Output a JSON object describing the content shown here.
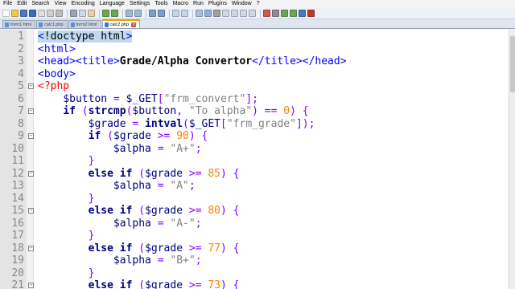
{
  "menu": [
    "File",
    "Edit",
    "Search",
    "View",
    "Encoding",
    "Language",
    "Settings",
    "Tools",
    "Macro",
    "Run",
    "Plugins",
    "Window",
    "?"
  ],
  "toolbar_icons": [
    "new-icon",
    "open-icon",
    "save-icon",
    "save-all-icon",
    "close-icon",
    "close-all-icon",
    "print-icon",
    "cut-icon",
    "copy-icon",
    "paste-icon",
    "undo-icon",
    "redo-icon",
    "find-icon",
    "replace-icon",
    "zoom-in-icon",
    "zoom-out-icon",
    "sync-v-icon",
    "sync-h-icon",
    "wrap-icon",
    "all-chars-icon",
    "indent-guide-icon",
    "udl-icon",
    "doc-map-icon",
    "function-list-icon",
    "folder-workspace-icon",
    "record-macro-icon",
    "stop-record-icon",
    "play-macro-icon",
    "run-macro-multiple-icon",
    "save-macro-icon",
    "spell-check-icon"
  ],
  "tabs": [
    {
      "label": "form1.html",
      "active": false
    },
    {
      "label": "calc1.php",
      "active": false
    },
    {
      "label": "form2.html",
      "active": false
    },
    {
      "label": "calc2.php",
      "active": true
    }
  ],
  "colors": {
    "tag": "#0000ff",
    "attr_doctype": "#000000",
    "php_delim": "#ff0000",
    "keyword": "#000080",
    "variable": "#000080",
    "string": "#808080",
    "number": "#ff8000",
    "operator": "#8000ff",
    "function": "#000080"
  },
  "lines": [
    {
      "n": "1",
      "fold": "",
      "tokens": [
        [
          "tag",
          "<"
        ],
        [
          "hlword",
          "!doctype html"
        ],
        [
          "tag",
          ">"
        ]
      ]
    },
    {
      "n": "2",
      "fold": "",
      "tokens": [
        [
          "tag",
          "<html>"
        ]
      ]
    },
    {
      "n": "3",
      "fold": "",
      "tokens": [
        [
          "tag",
          "<head><title>"
        ],
        [
          "boldtext",
          "Grade/Alpha Convertor"
        ],
        [
          "tag",
          "</title></head>"
        ]
      ]
    },
    {
      "n": "4",
      "fold": "",
      "tokens": [
        [
          "tag",
          "<body>"
        ]
      ]
    },
    {
      "n": "5",
      "fold": "-",
      "tokens": [
        [
          "php",
          "<?php"
        ]
      ]
    },
    {
      "n": "6",
      "fold": "",
      "tokens": [
        [
          "plain",
          "    "
        ],
        [
          "var",
          "$button"
        ],
        [
          "op",
          " = "
        ],
        [
          "var",
          "$_GET"
        ],
        [
          "op",
          "["
        ],
        [
          "str",
          "\"frm_convert\""
        ],
        [
          "op",
          "];"
        ]
      ]
    },
    {
      "n": "7",
      "fold": "-",
      "tokens": [
        [
          "plain",
          "    "
        ],
        [
          "kw",
          "if"
        ],
        [
          "op",
          " ("
        ],
        [
          "fn",
          "strcmp"
        ],
        [
          "op",
          "("
        ],
        [
          "var",
          "$button"
        ],
        [
          "op",
          ", "
        ],
        [
          "str",
          "\"To alpha\""
        ],
        [
          "op",
          ") == "
        ],
        [
          "num",
          "0"
        ],
        [
          "op",
          ") {"
        ]
      ]
    },
    {
      "n": "8",
      "fold": "",
      "tokens": [
        [
          "plain",
          "        "
        ],
        [
          "var",
          "$grade"
        ],
        [
          "op",
          " = "
        ],
        [
          "fn",
          "intval"
        ],
        [
          "op",
          "("
        ],
        [
          "var",
          "$_GET"
        ],
        [
          "op",
          "["
        ],
        [
          "str",
          "\"frm_grade\""
        ],
        [
          "op",
          "]);"
        ]
      ]
    },
    {
      "n": "9",
      "fold": "-",
      "tokens": [
        [
          "plain",
          "        "
        ],
        [
          "kw",
          "if"
        ],
        [
          "op",
          " ("
        ],
        [
          "var",
          "$grade"
        ],
        [
          "op",
          " >= "
        ],
        [
          "num",
          "90"
        ],
        [
          "op",
          ") {"
        ]
      ]
    },
    {
      "n": "10",
      "fold": "",
      "tokens": [
        [
          "plain",
          "            "
        ],
        [
          "var",
          "$alpha"
        ],
        [
          "op",
          " = "
        ],
        [
          "str",
          "\"A+\""
        ],
        [
          "op",
          ";"
        ]
      ]
    },
    {
      "n": "11",
      "fold": "",
      "tokens": [
        [
          "plain",
          "        "
        ],
        [
          "op",
          "}"
        ]
      ]
    },
    {
      "n": "12",
      "fold": "-",
      "tokens": [
        [
          "plain",
          "        "
        ],
        [
          "kw",
          "else if"
        ],
        [
          "op",
          " ("
        ],
        [
          "var",
          "$grade"
        ],
        [
          "op",
          " >= "
        ],
        [
          "num",
          "85"
        ],
        [
          "op",
          ") {"
        ]
      ]
    },
    {
      "n": "13",
      "fold": "",
      "tokens": [
        [
          "plain",
          "            "
        ],
        [
          "var",
          "$alpha"
        ],
        [
          "op",
          " = "
        ],
        [
          "str",
          "\"A\""
        ],
        [
          "op",
          ";"
        ]
      ]
    },
    {
      "n": "14",
      "fold": "",
      "tokens": [
        [
          "plain",
          "        "
        ],
        [
          "op",
          "}"
        ]
      ]
    },
    {
      "n": "15",
      "fold": "-",
      "tokens": [
        [
          "plain",
          "        "
        ],
        [
          "kw",
          "else if"
        ],
        [
          "op",
          " ("
        ],
        [
          "var",
          "$grade"
        ],
        [
          "op",
          " >= "
        ],
        [
          "num",
          "80"
        ],
        [
          "op",
          ") {"
        ]
      ]
    },
    {
      "n": "16",
      "fold": "",
      "tokens": [
        [
          "plain",
          "            "
        ],
        [
          "var",
          "$alpha"
        ],
        [
          "op",
          " = "
        ],
        [
          "str",
          "\"A-\""
        ],
        [
          "op",
          ";"
        ]
      ]
    },
    {
      "n": "17",
      "fold": "",
      "tokens": [
        [
          "plain",
          "        "
        ],
        [
          "op",
          "}"
        ]
      ]
    },
    {
      "n": "18",
      "fold": "-",
      "tokens": [
        [
          "plain",
          "        "
        ],
        [
          "kw",
          "else if"
        ],
        [
          "op",
          " ("
        ],
        [
          "var",
          "$grade"
        ],
        [
          "op",
          " >= "
        ],
        [
          "num",
          "77"
        ],
        [
          "op",
          ") {"
        ]
      ]
    },
    {
      "n": "19",
      "fold": "",
      "tokens": [
        [
          "plain",
          "            "
        ],
        [
          "var",
          "$alpha"
        ],
        [
          "op",
          " = "
        ],
        [
          "str",
          "\"B+\""
        ],
        [
          "op",
          ";"
        ]
      ]
    },
    {
      "n": "20",
      "fold": "",
      "tokens": [
        [
          "plain",
          "        "
        ],
        [
          "op",
          "}"
        ]
      ]
    },
    {
      "n": "21",
      "fold": "-",
      "tokens": [
        [
          "plain",
          "        "
        ],
        [
          "kw",
          "else if"
        ],
        [
          "op",
          " ("
        ],
        [
          "var",
          "$grade"
        ],
        [
          "op",
          " >= "
        ],
        [
          "num",
          "73"
        ],
        [
          "op",
          ") {"
        ]
      ]
    }
  ]
}
